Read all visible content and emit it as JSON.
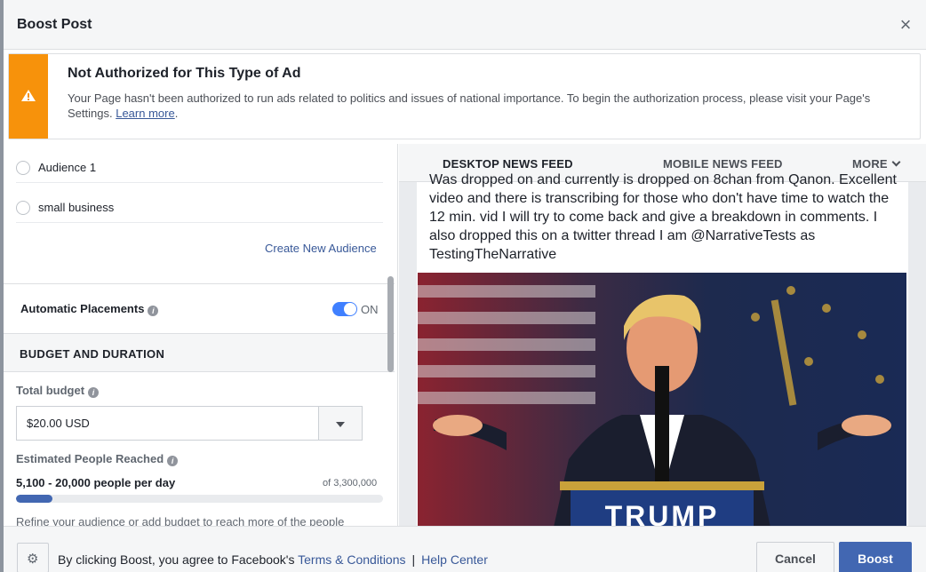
{
  "dialog": {
    "title": "Boost Post",
    "close_icon": "close-icon"
  },
  "warning": {
    "icon": "warning-icon",
    "accent_color": "#f7920b",
    "title": "Not Authorized for This Type of Ad",
    "body": "Your Page hasn't been authorized to run ads related to politics and issues of national importance. To begin the authorization process, please visit your Page's Settings.",
    "link": "Learn more"
  },
  "audience": {
    "options": [
      "Audience 1",
      "small business"
    ],
    "create_label": "Create New Audience"
  },
  "placements": {
    "label": "Automatic Placements",
    "toggle_state": "ON"
  },
  "budget": {
    "section_title": "BUDGET AND DURATION",
    "total_label": "Total budget",
    "value": "$20.00 USD",
    "reach_label": "Estimated People Reached",
    "reach_range": "5,100 - 20,000 people per day",
    "reach_total": "of 3,300,000",
    "reach_fraction": 0.1,
    "refine_hint": "Refine your audience or add budget to reach more of the people"
  },
  "preview": {
    "tabs": [
      "DESKTOP NEWS FEED",
      "MOBILE NEWS FEED",
      "MORE"
    ],
    "active_tab": 0,
    "post_text": "Was dropped on and currently is dropped on 8chan from Qanon. Excellent video and there is transcribing for those who don't have time to watch the 12 min. vid I will try to come back and give a breakdown in comments. I also dropped this on a twitter thread I am @NarrativeTests as TestingTheNarrative",
    "image_sign": "TRUMP"
  },
  "footer": {
    "settings_icon": "gear-icon",
    "terms_prefix": "By clicking Boost, you agree to Facebook's",
    "terms_link": "Terms & Conditions",
    "separator": "|",
    "help_link": "Help Center",
    "cancel_label": "Cancel",
    "boost_label": "Boost"
  },
  "colors": {
    "brand": "#4267b2",
    "link": "#385898",
    "warning": "#f7920b"
  }
}
